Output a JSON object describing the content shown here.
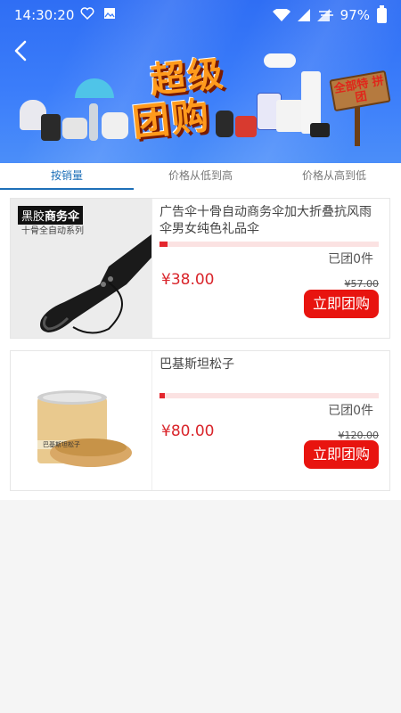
{
  "status_bar": {
    "time": "14:30:20",
    "battery": "97%"
  },
  "banner": {
    "title_line1": "超级",
    "title_line2": "团购",
    "sign_text": "全部特 拼团"
  },
  "tabs": [
    {
      "label": "按销量",
      "active": true
    },
    {
      "label": "价格从低到高",
      "active": false
    },
    {
      "label": "价格从高到低",
      "active": false
    }
  ],
  "products": [
    {
      "name": "广告伞十骨自动商务伞加大折叠抗风雨伞男女纯色礼品伞",
      "thumb_brand": "黑胶",
      "thumb_title": "商务伞",
      "thumb_sub": "十骨全自动系列",
      "sold": "已团0件",
      "price": "¥38.00",
      "original_price": "¥57.00",
      "buy_label": "立即团购"
    },
    {
      "name": "巴基斯坦松子",
      "thumb_label": "巴基斯坦松子",
      "sold": "已团0件",
      "price": "¥80.00",
      "original_price": "¥120.00",
      "buy_label": "立即团购"
    }
  ],
  "colors": {
    "banner_blue": "#3b7dfa",
    "tab_active": "#1d6fb8",
    "price_red": "#d9252b",
    "buy_button": "#e8140f"
  }
}
